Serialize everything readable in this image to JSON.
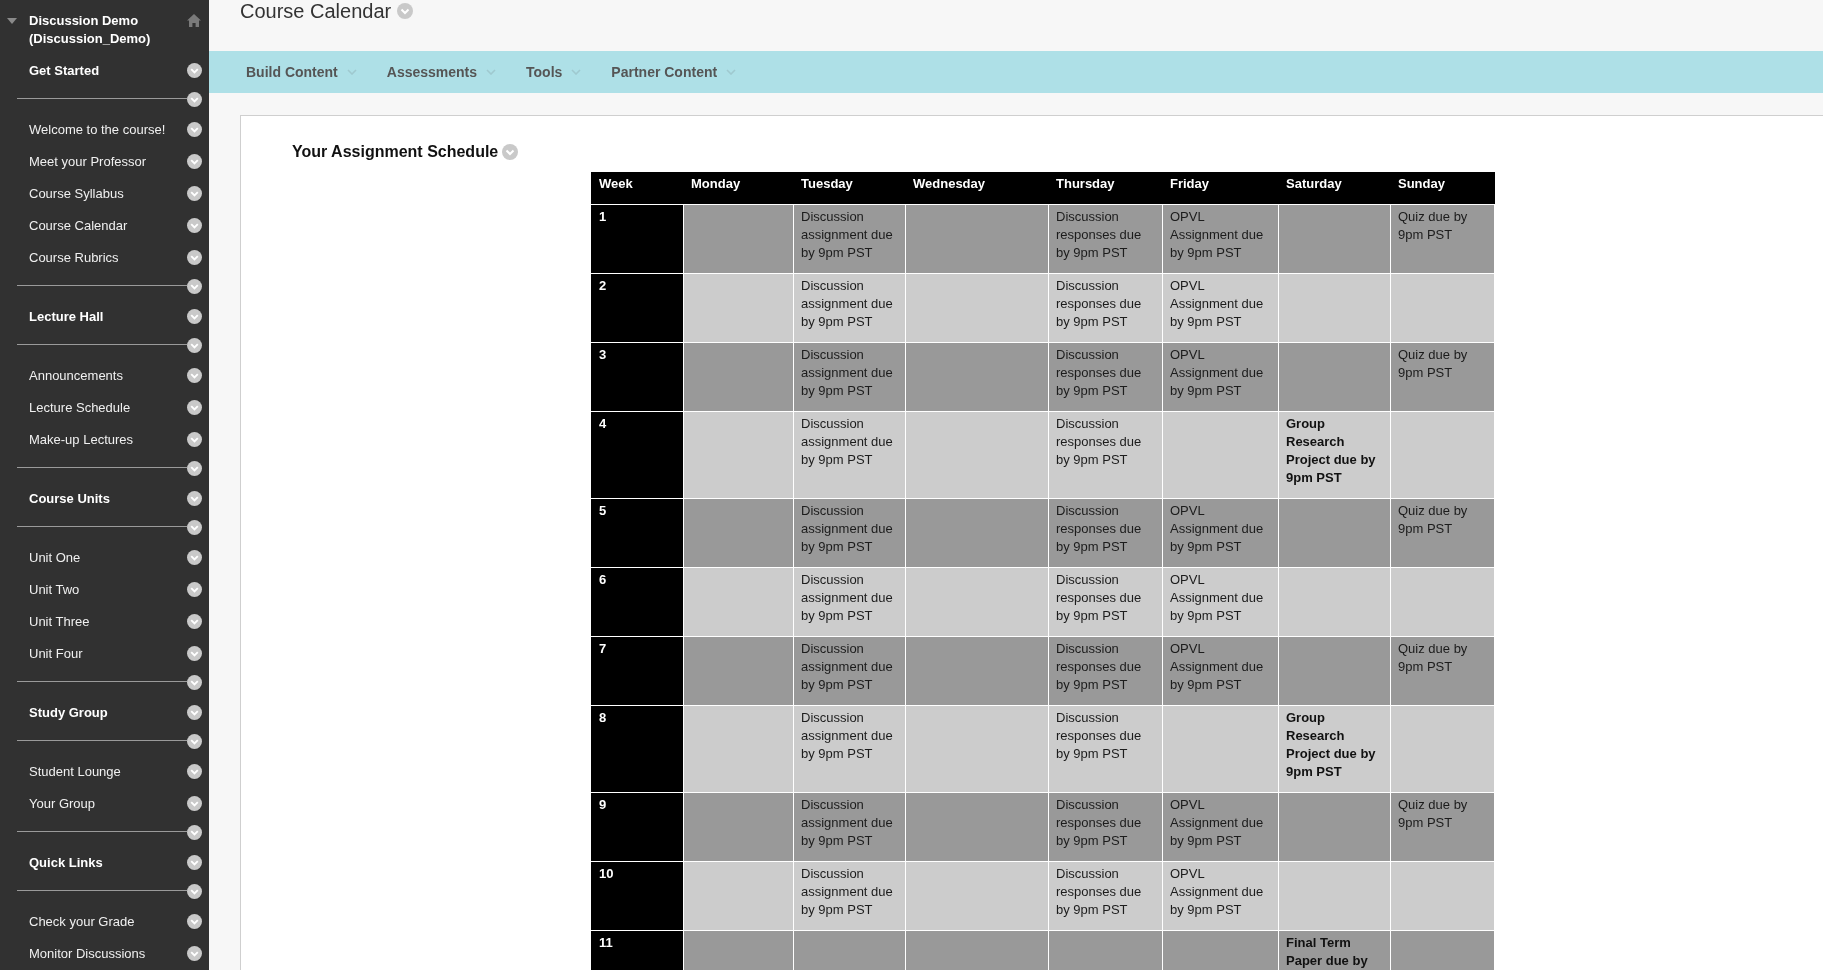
{
  "sidebar": {
    "course_title": "Discussion Demo (Discussion_Demo)",
    "expanded": true,
    "sections": [
      {
        "heading": "Get Started",
        "items": [
          "Welcome to the course!",
          "Meet your Professor",
          "Course Syllabus",
          "Course Calendar",
          "Course Rubrics"
        ]
      },
      {
        "heading": "Lecture Hall",
        "items": [
          "Announcements",
          "Lecture Schedule",
          "Make-up Lectures"
        ]
      },
      {
        "heading": "Course Units",
        "items": [
          "Unit One",
          "Unit Two",
          "Unit Three",
          "Unit Four"
        ]
      },
      {
        "heading": "Study Group",
        "items": [
          "Student Lounge",
          "Your Group"
        ]
      },
      {
        "heading": "Quick Links",
        "items": [
          "Check your Grade",
          "Monitor Discussions"
        ]
      }
    ]
  },
  "page": {
    "title": "Course Calendar"
  },
  "toolbar": {
    "menus": [
      "Build Content",
      "Assessments",
      "Tools",
      "Partner Content"
    ]
  },
  "content": {
    "heading": "Your Assignment Schedule",
    "table": {
      "columns": [
        "Week",
        "Monday",
        "Tuesday",
        "Wednesday",
        "Thursday",
        "Friday",
        "Saturday",
        "Sunday"
      ],
      "rows": [
        {
          "cells": [
            {
              "text": "1",
              "bold": true
            },
            null,
            {
              "text": "Discussion assignment due by 9pm PST",
              "bold": false
            },
            null,
            {
              "text": "Discussion responses due by 9pm PST",
              "bold": false
            },
            {
              "text": "OPVL Assignment due by 9pm PST",
              "bold": false
            },
            null,
            {
              "text": "Quiz due by 9pm PST",
              "bold": false
            }
          ]
        },
        {
          "cells": [
            {
              "text": "2",
              "bold": true
            },
            null,
            {
              "text": "Discussion assignment due by 9pm PST",
              "bold": false
            },
            null,
            {
              "text": "Discussion responses due by 9pm PST",
              "bold": false
            },
            {
              "text": "OPVL Assignment due by 9pm PST",
              "bold": false
            },
            null,
            null
          ]
        },
        {
          "cells": [
            {
              "text": "3",
              "bold": true
            },
            null,
            {
              "text": "Discussion assignment due by 9pm PST",
              "bold": false
            },
            null,
            {
              "text": "Discussion responses due by 9pm PST",
              "bold": false
            },
            {
              "text": "OPVL Assignment due by 9pm PST",
              "bold": false
            },
            null,
            {
              "text": "Quiz due by 9pm PST",
              "bold": false
            }
          ]
        },
        {
          "cells": [
            {
              "text": "4",
              "bold": true
            },
            null,
            {
              "text": "Discussion assignment due by 9pm PST",
              "bold": false
            },
            null,
            {
              "text": "Discussion responses due by 9pm PST",
              "bold": false
            },
            null,
            {
              "text": "Group Research Project due by 9pm PST",
              "bold": true
            },
            null
          ]
        },
        {
          "cells": [
            {
              "text": "5",
              "bold": true
            },
            null,
            {
              "text": "Discussion assignment due by 9pm PST",
              "bold": false
            },
            null,
            {
              "text": "Discussion responses due by 9pm PST",
              "bold": false
            },
            {
              "text": "OPVL Assignment due by 9pm PST",
              "bold": false
            },
            null,
            {
              "text": "Quiz due by 9pm PST",
              "bold": false
            }
          ]
        },
        {
          "cells": [
            {
              "text": "6",
              "bold": true
            },
            null,
            {
              "text": "Discussion assignment due by 9pm PST",
              "bold": false
            },
            null,
            {
              "text": "Discussion responses due by 9pm PST",
              "bold": false
            },
            {
              "text": "OPVL Assignment due by 9pm PST",
              "bold": false
            },
            null,
            null
          ]
        },
        {
          "cells": [
            {
              "text": "7",
              "bold": true
            },
            null,
            {
              "text": "Discussion assignment due by 9pm PST",
              "bold": false
            },
            null,
            {
              "text": "Discussion responses due by 9pm PST",
              "bold": false
            },
            {
              "text": "OPVL Assignment due by 9pm PST",
              "bold": false
            },
            null,
            {
              "text": "Quiz due by 9pm PST",
              "bold": false
            }
          ]
        },
        {
          "cells": [
            {
              "text": "8",
              "bold": true
            },
            null,
            {
              "text": "Discussion assignment due by 9pm PST",
              "bold": false
            },
            null,
            {
              "text": "Discussion responses due by 9pm PST",
              "bold": false
            },
            null,
            {
              "text": "Group Research Project due by 9pm PST",
              "bold": true
            },
            null
          ]
        },
        {
          "cells": [
            {
              "text": "9",
              "bold": true
            },
            null,
            {
              "text": "Discussion assignment due by 9pm PST",
              "bold": false
            },
            null,
            {
              "text": "Discussion responses due by 9pm PST",
              "bold": false
            },
            {
              "text": "OPVL Assignment due by 9pm PST",
              "bold": false
            },
            null,
            {
              "text": "Quiz due by 9pm PST",
              "bold": false
            }
          ]
        },
        {
          "cells": [
            {
              "text": "10",
              "bold": true
            },
            null,
            {
              "text": "Discussion assignment due by 9pm PST",
              "bold": false
            },
            null,
            {
              "text": "Discussion responses due by 9pm PST",
              "bold": false
            },
            {
              "text": "OPVL Assignment due by 9pm PST",
              "bold": false
            },
            null,
            null
          ]
        },
        {
          "cells": [
            {
              "text": "11",
              "bold": true
            },
            null,
            null,
            null,
            null,
            null,
            {
              "text": "Final Term Paper due by",
              "bold": true
            },
            null
          ]
        }
      ]
    }
  }
}
